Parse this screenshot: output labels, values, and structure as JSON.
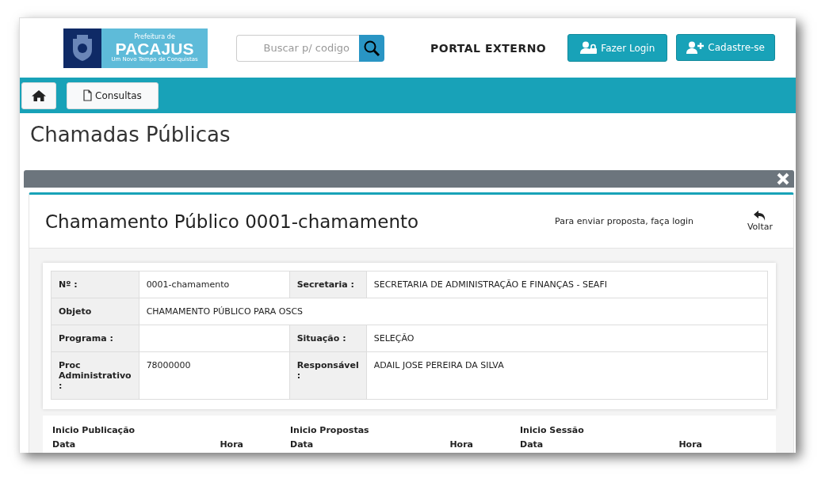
{
  "header": {
    "logo": {
      "line_1": "Prefeitura de",
      "line_2": "PACAJUS",
      "line_3": "Um Novo Tempo de Conquistas"
    },
    "search": {
      "placeholder": "Buscar p/ codigo"
    },
    "portal_title": "PORTAL EXTERNO",
    "buttons": [
      {
        "label": "Fazer Login",
        "kind": "login"
      },
      {
        "label": "Cadastre-se",
        "kind": "register"
      }
    ]
  },
  "nav": {
    "items": [
      {
        "kind": "home"
      },
      {
        "kind": "page",
        "label": "Consultas"
      }
    ]
  },
  "page_title": "Chamadas Públicas",
  "panel": {
    "title": "Chamamento Público 0001-chamamento",
    "notice": "Para enviar proposta, faça login",
    "back_button": "Voltar",
    "details": [
      {
        "label": "Nº :",
        "value": "0001-chamamento",
        "label_2": "Secretaria :",
        "value_2": "SECRETARIA DE ADMINISTRAÇÃO E FINANÇAS - SEAFI"
      },
      {
        "label": "Objeto",
        "value": "CHAMAMENTO PÚBLICO PARA OSCS"
      },
      {
        "label": "Programa :",
        "label_2": "Situação :",
        "value_2": "SELEÇÃO"
      },
      {
        "label": "Proc Administrativo :",
        "value": "78000000",
        "label_2": "Responsável :",
        "value_2": "ADAIL JOSE PEREIRA DA SILVA"
      }
    ],
    "dates": [
      {
        "title": "Inicio Publicação",
        "col_1": "Data",
        "col_2": "Hora"
      },
      {
        "title": "Inicio Propostas",
        "col_1": "Data",
        "col_2": "Hora"
      },
      {
        "title": "Inicio Sessão",
        "col_1": "Data",
        "col_2": "Hora"
      }
    ]
  }
}
